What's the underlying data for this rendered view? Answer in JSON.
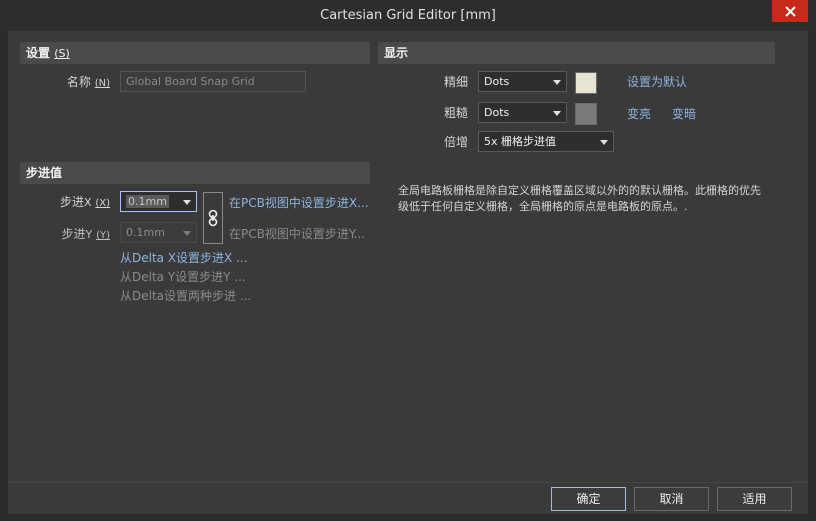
{
  "window": {
    "title": "Cartesian Grid Editor [mm]",
    "close_glyph": "✕"
  },
  "settings": {
    "header": "设置",
    "header_key": "(S)",
    "name_label": "名称",
    "name_key": "(N)",
    "name_value": "Global Board Snap Grid"
  },
  "step": {
    "header": "步进值",
    "step_x_label": "步进",
    "step_x_axis": "X",
    "step_x_key": "(X)",
    "step_x_value": "0.1mm",
    "step_y_label": "步进",
    "step_y_axis": "Y",
    "step_y_key": "(Y)",
    "step_y_value": "0.1mm",
    "set_x_from_pcb": "在PCB视图中设置步进X...",
    "set_y_from_pcb": "在PCB视图中设置步进Y...",
    "from_delta_x": "从Delta X设置步进X ...",
    "from_delta_y": "从Delta Y设置步进Y ...",
    "from_delta_both": "从Delta设置两种步进 ..."
  },
  "display": {
    "header": "显示",
    "fine_label": "精细",
    "fine_value": "Dots",
    "fine_color": "#e8e4d4",
    "coarse_label": "粗糙",
    "coarse_value": "Dots",
    "coarse_color": "#7a7a7a",
    "multiplier_label": "倍增",
    "multiplier_value": "5x 栅格步进值",
    "set_default": "设置为默认",
    "lighter": "变亮",
    "darker": "变暗",
    "description": "全局电路板栅格是除自定义栅格覆盖区域以外的的默认栅格。此栅格的优先级低于任何自定义栅格，全局栅格的原点是电路板的原点。."
  },
  "footer": {
    "ok": "确定",
    "cancel": "取消",
    "apply": "适用"
  }
}
